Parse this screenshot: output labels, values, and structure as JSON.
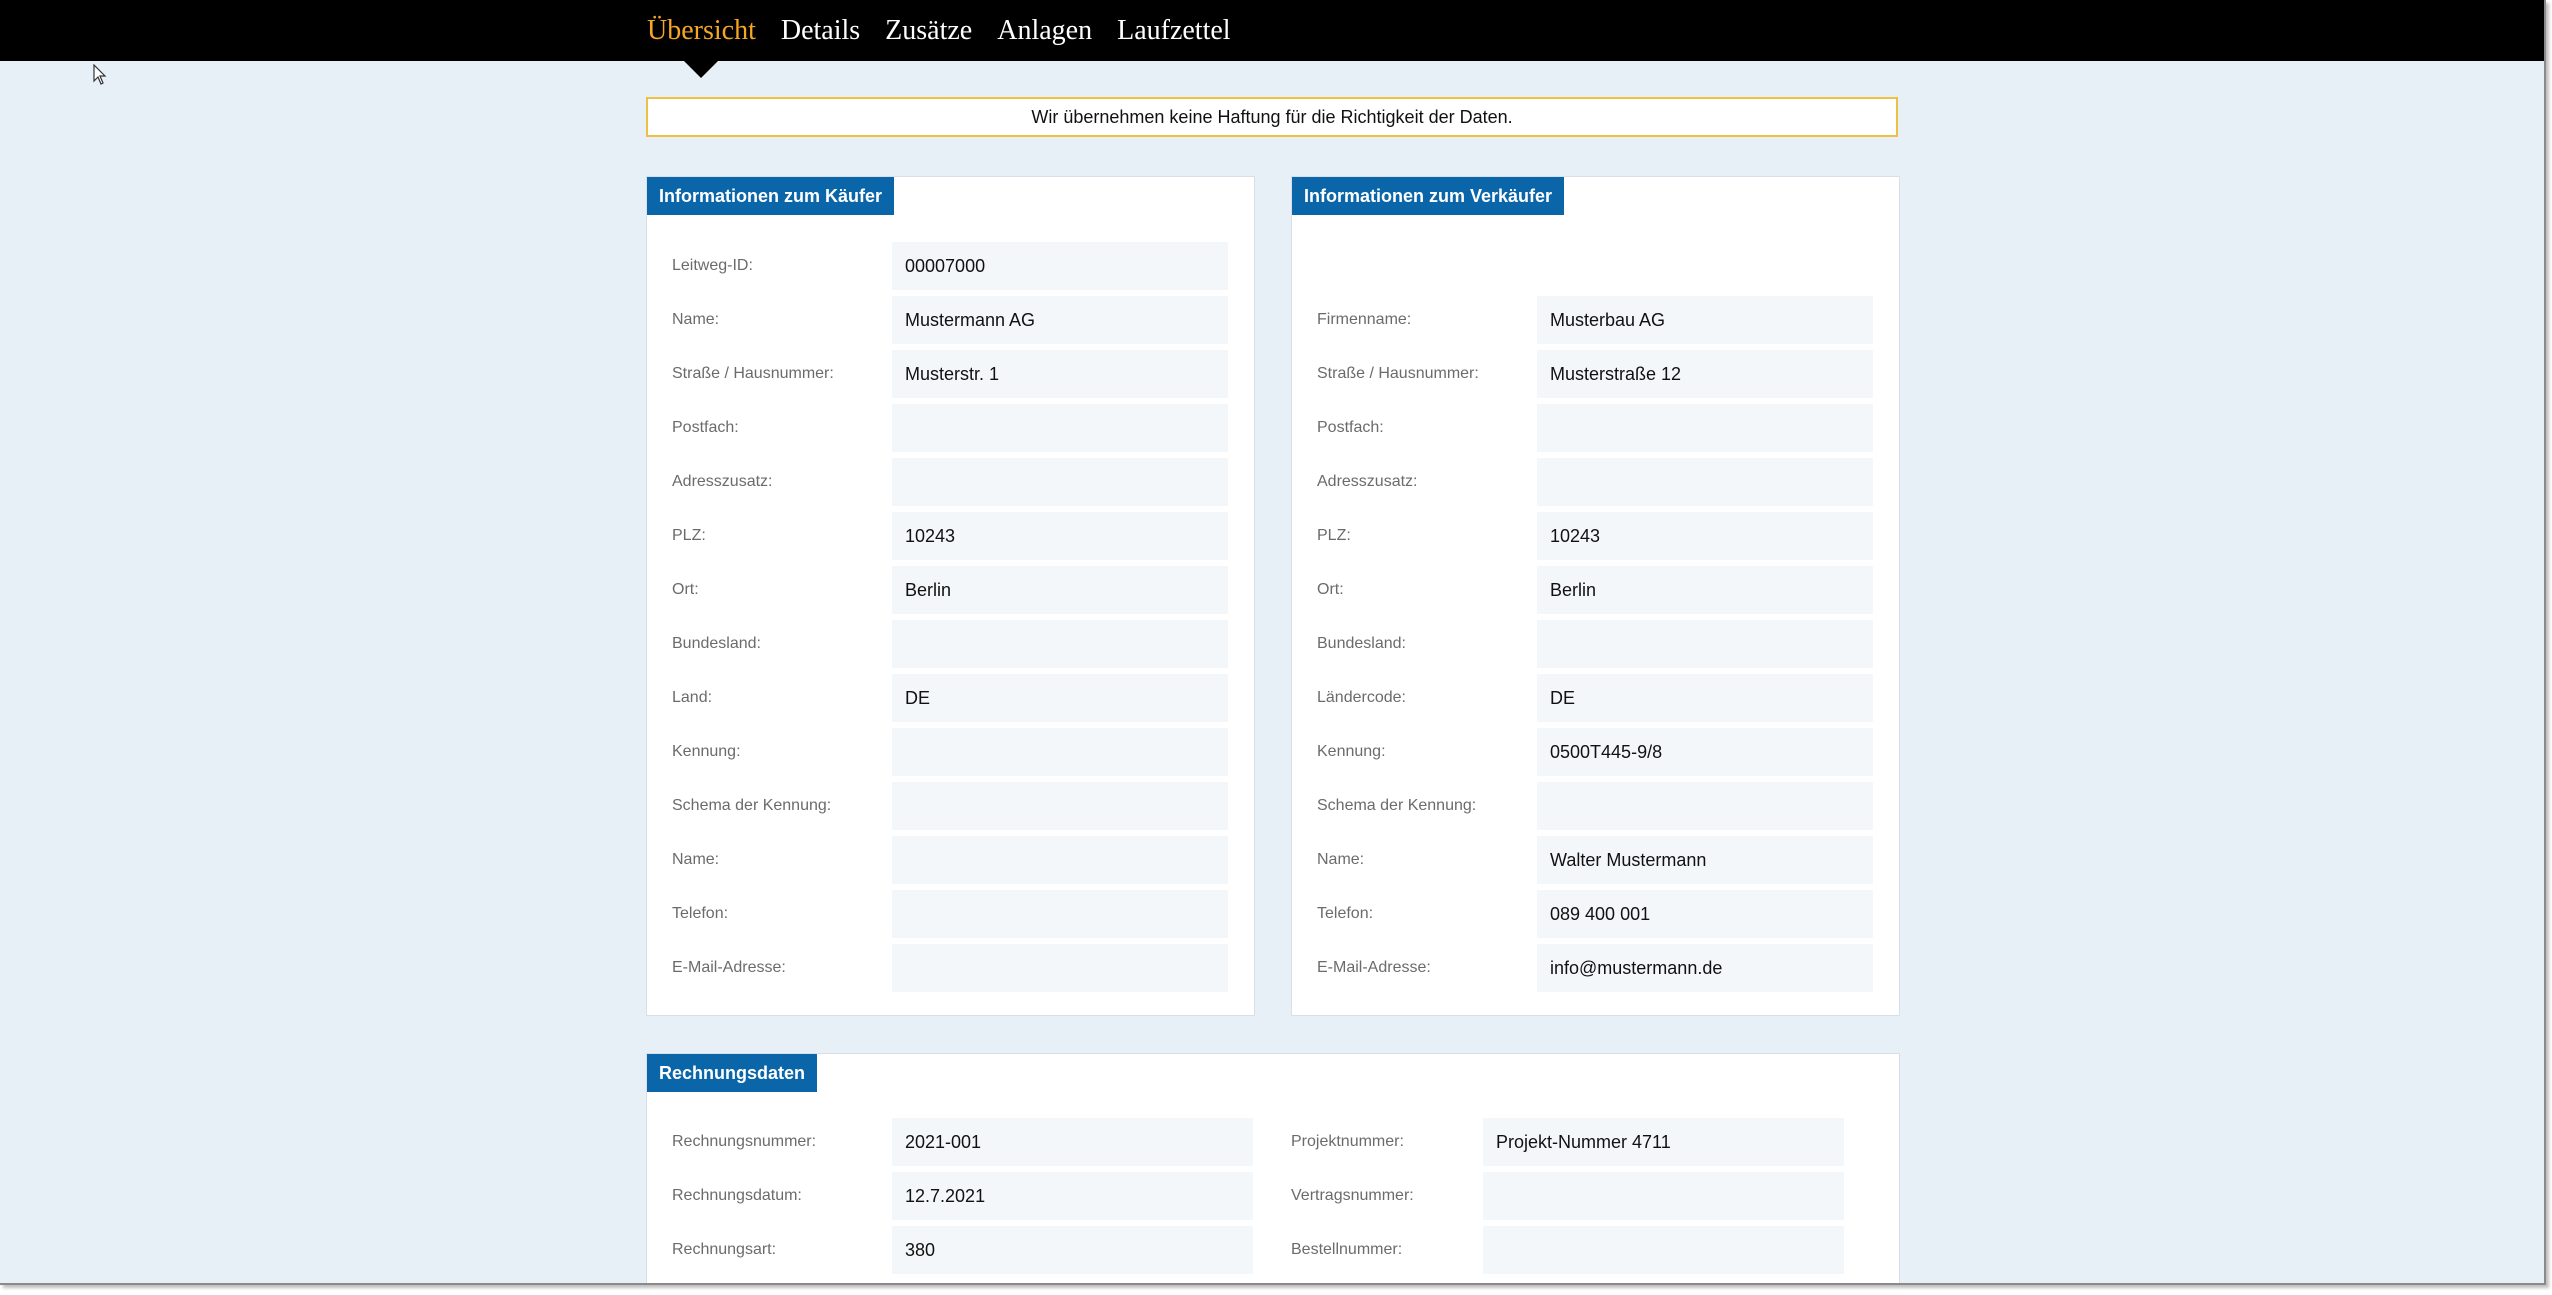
{
  "nav": {
    "tabs": [
      {
        "label": "Übersicht"
      },
      {
        "label": "Details"
      },
      {
        "label": "Zusätze"
      },
      {
        "label": "Anlagen"
      },
      {
        "label": "Laufzettel"
      }
    ]
  },
  "notice": "Wir übernehmen keine Haftung für die Richtigkeit der Daten.",
  "buyer": {
    "title": "Informationen zum Käufer",
    "fields": [
      {
        "label": "Leitweg-ID:",
        "value": "00007000"
      },
      {
        "label": "Name:",
        "value": "Mustermann AG"
      },
      {
        "label": "Straße / Hausnummer:",
        "value": "Musterstr. 1"
      },
      {
        "label": "Postfach:",
        "value": ""
      },
      {
        "label": "Adresszusatz:",
        "value": ""
      },
      {
        "label": "PLZ:",
        "value": "10243"
      },
      {
        "label": "Ort:",
        "value": "Berlin"
      },
      {
        "label": "Bundesland:",
        "value": ""
      },
      {
        "label": "Land:",
        "value": "DE"
      },
      {
        "label": "Kennung:",
        "value": ""
      },
      {
        "label": "Schema der Kennung:",
        "value": ""
      },
      {
        "label": "Name:",
        "value": ""
      },
      {
        "label": "Telefon:",
        "value": ""
      },
      {
        "label": "E-Mail-Adresse:",
        "value": ""
      }
    ]
  },
  "seller": {
    "title": "Informationen zum Verkäufer",
    "fields": [
      {
        "label": "Firmenname:",
        "value": "Musterbau AG"
      },
      {
        "label": "Straße / Hausnummer:",
        "value": "Musterstraße 12"
      },
      {
        "label": "Postfach:",
        "value": ""
      },
      {
        "label": "Adresszusatz:",
        "value": ""
      },
      {
        "label": "PLZ:",
        "value": "10243"
      },
      {
        "label": "Ort:",
        "value": "Berlin"
      },
      {
        "label": "Bundesland:",
        "value": ""
      },
      {
        "label": "Ländercode:",
        "value": "DE"
      },
      {
        "label": "Kennung:",
        "value": "0500T445-9/8"
      },
      {
        "label": "Schema der Kennung:",
        "value": ""
      },
      {
        "label": "Name:",
        "value": "Walter Mustermann"
      },
      {
        "label": "Telefon:",
        "value": "089 400 001"
      },
      {
        "label": "E-Mail-Adresse:",
        "value": "info@mustermann.de"
      }
    ]
  },
  "invoice": {
    "title": "Rechnungsdaten",
    "left": [
      {
        "label": "Rechnungsnummer:",
        "value": "2021-001"
      },
      {
        "label": "Rechnungsdatum:",
        "value": "12.7.2021"
      },
      {
        "label": "Rechnungsart:",
        "value": "380"
      }
    ],
    "right": [
      {
        "label": "Projektnummer:",
        "value": "Projekt-Nummer 4711"
      },
      {
        "label": "Vertragsnummer:",
        "value": ""
      },
      {
        "label": "Bestellnummer:",
        "value": ""
      }
    ]
  },
  "colors": {
    "nav_active": "#f5a623",
    "panel_header": "#0a66a8",
    "notice_border": "#f0c040",
    "page_bg": "#e8f0f7"
  }
}
